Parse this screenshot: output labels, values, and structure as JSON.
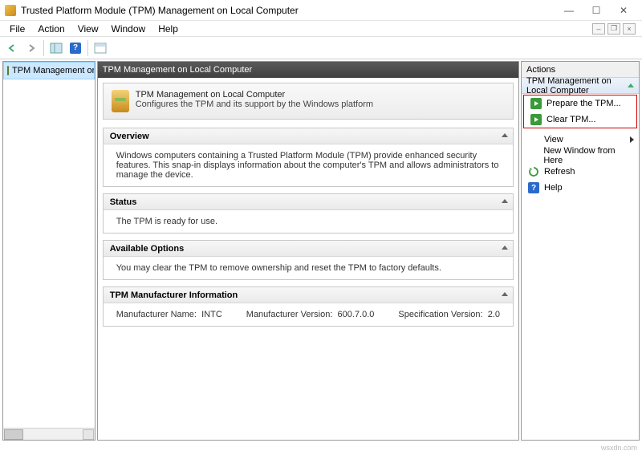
{
  "window": {
    "title": "Trusted Platform Module (TPM) Management on Local Computer"
  },
  "menu": {
    "file": "File",
    "action": "Action",
    "view": "View",
    "window": "Window",
    "help": "Help"
  },
  "tree": {
    "root": "TPM Management on Local Compu"
  },
  "center": {
    "header": "TPM Management on Local Computer",
    "banner_title": "TPM Management on Local Computer",
    "banner_desc": "Configures the TPM and its support by the Windows platform",
    "overview": {
      "title": "Overview",
      "body": "Windows computers containing a Trusted Platform Module (TPM) provide enhanced security features. This snap-in displays information about the computer's TPM and allows administrators to manage the device."
    },
    "status": {
      "title": "Status",
      "body": "The TPM is ready for use."
    },
    "options": {
      "title": "Available Options",
      "body": "You may clear the TPM to remove ownership and reset the TPM to factory defaults."
    },
    "mfr": {
      "title": "TPM Manufacturer Information",
      "name_label": "Manufacturer Name:",
      "name_value": "INTC",
      "ver_label": "Manufacturer Version:",
      "ver_value": "600.7.0.0",
      "spec_label": "Specification Version:",
      "spec_value": "2.0"
    }
  },
  "actions": {
    "header": "Actions",
    "group": "TPM Management on Local Computer",
    "prepare": "Prepare the TPM...",
    "clear": "Clear TPM...",
    "view": "View",
    "new_window": "New Window from Here",
    "refresh": "Refresh",
    "help": "Help"
  },
  "footer": "wsxdn.com"
}
